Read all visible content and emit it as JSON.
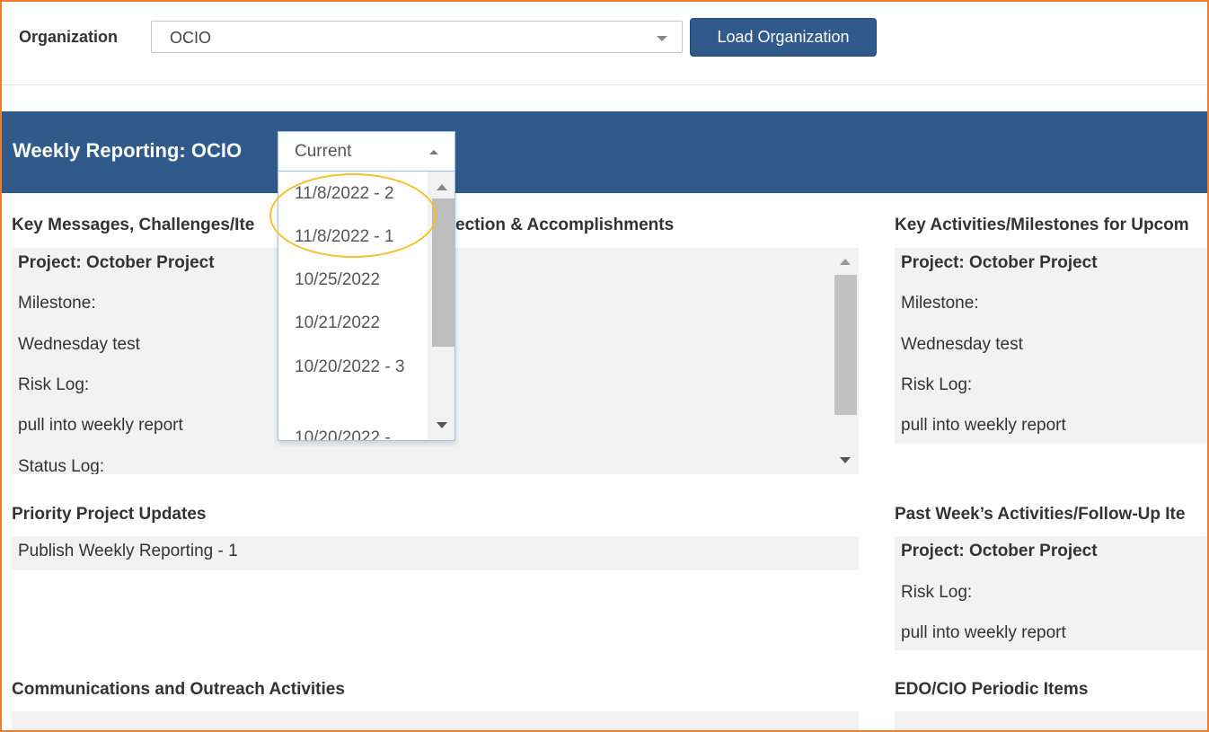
{
  "org_bar": {
    "label": "Organization",
    "selected": "OCIO",
    "load_button": "Load Organization"
  },
  "banner": {
    "title": "Weekly Reporting: OCIO",
    "period_selected": "Current",
    "period_options": [
      "11/8/2022 - 2",
      "11/8/2022 - 1",
      "10/25/2022",
      "10/21/2022",
      "10/20/2022 - 3",
      "10/20/2022 -"
    ]
  },
  "sections": {
    "key_messages": {
      "title": "Key Messages, Challenges/Ite",
      "title_rest": "ection & Accomplishments",
      "lines": [
        "Project: October Project",
        "Milestone:",
        "Wednesday test",
        "Risk Log:",
        "pull into weekly report",
        "Status Log:"
      ]
    },
    "key_activities": {
      "title": "Key Activities/Milestones for Upcom",
      "lines": [
        "Project: October Project",
        "Milestone:",
        "Wednesday test",
        "Risk Log:",
        "pull into weekly report"
      ]
    },
    "priority_updates": {
      "title": "Priority Project Updates",
      "lines": [
        "Publish Weekly Reporting - 1"
      ]
    },
    "past_week": {
      "title": "Past Week’s Activities/Follow-Up Ite",
      "lines": [
        "Project: October Project",
        "Risk Log:",
        "pull into weekly report"
      ]
    },
    "communications": {
      "title": "Communications and Outreach Activities"
    },
    "edo_cio": {
      "title": "EDO/CIO Periodic Items"
    }
  },
  "colors": {
    "primary_blue": "#2f5a8a",
    "frame_orange": "#ed7d31",
    "highlight_yellow": "#f2c12e",
    "panel_gray": "#f2f2f2"
  }
}
